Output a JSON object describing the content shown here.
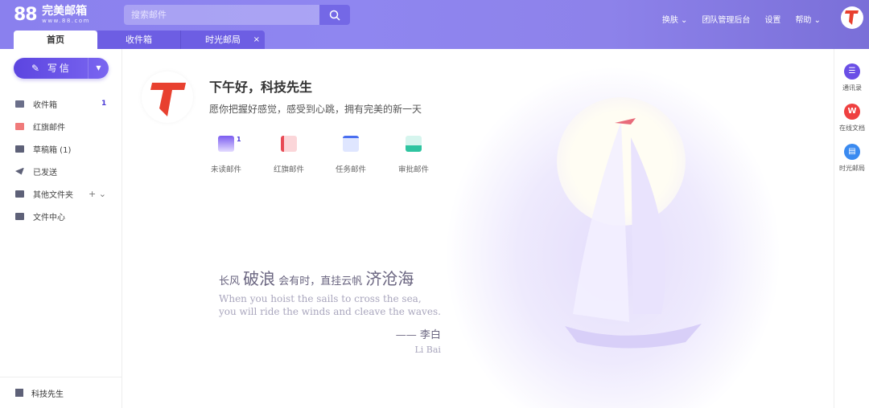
{
  "header": {
    "logo_num": "88",
    "logo_text": "完美邮箱",
    "logo_url_text": "www.88.com",
    "search_placeholder": "搜索邮件",
    "tabs": [
      {
        "label": "首页"
      },
      {
        "label": "收件箱"
      },
      {
        "label": "时光邮局",
        "close": "×"
      }
    ],
    "nav": [
      "换肤 ⌄",
      "团队管理后台",
      "设置",
      "帮助 ⌄"
    ]
  },
  "sidebar": {
    "compose": "写信",
    "items": [
      {
        "label": "收件箱",
        "badge": "1"
      },
      {
        "label": "红旗邮件"
      },
      {
        "label": "草稿箱 (1)"
      },
      {
        "label": "已发送"
      },
      {
        "label": "其他文件夹",
        "extra": "+  ⌄"
      },
      {
        "label": "文件中心"
      }
    ],
    "user": "科技先生"
  },
  "main": {
    "greeting": "下午好，科技先生",
    "subtitle": "愿你把握好感觉，感受到心跳，拥有完美的新一天",
    "quick": [
      {
        "label": "未读邮件",
        "badge": "1"
      },
      {
        "label": "红旗邮件"
      },
      {
        "label": "任务邮件"
      },
      {
        "label": "审批邮件"
      }
    ],
    "poem": {
      "p1": "长风 ",
      "p2": "破浪",
      "p3": " 会有时，直挂云帆 ",
      "p4": "济沧海",
      "en1": "When you hoist the sails to cross the sea,",
      "en2": "you will ride the winds and cleave the waves.",
      "author": "—— 李白",
      "author_en": "Li Bai"
    }
  },
  "rail": [
    {
      "label": "通讯录"
    },
    {
      "label": "在线文档"
    },
    {
      "label": "时光邮局"
    }
  ],
  "colors": {
    "primary": "#6a57e6",
    "red": "#e8402f"
  }
}
